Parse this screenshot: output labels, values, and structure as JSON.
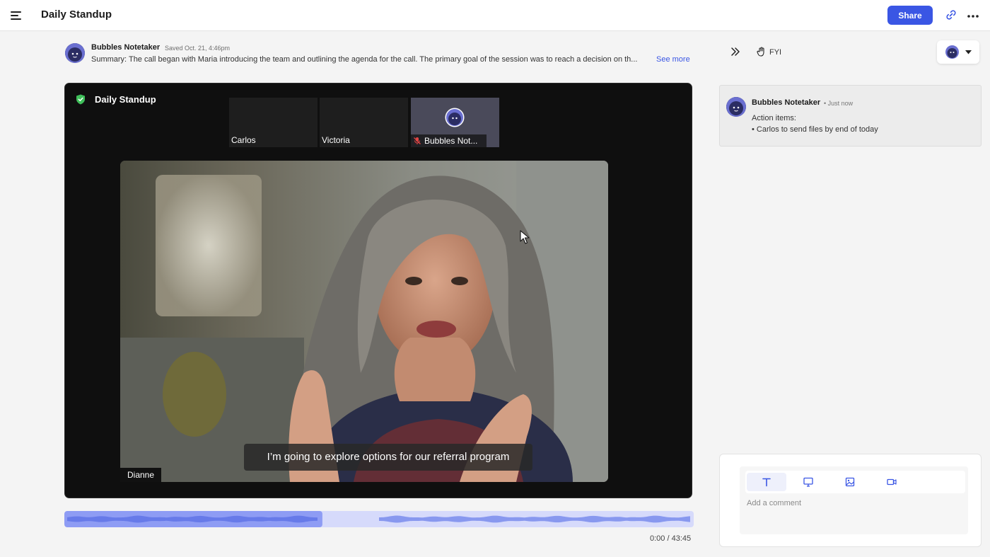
{
  "header": {
    "title": "Daily Standup",
    "share_label": "Share"
  },
  "summary": {
    "author": "Bubbles Notetaker",
    "saved": "Saved Oct. 21, 4:46pm",
    "text": "Summary: The call began with Maria introducing the team and outlining the agenda for the call. The primary goal of the session was to reach a decision on th...",
    "see_more": "See more"
  },
  "call": {
    "title": "Daily Standup",
    "participants": [
      "Carlos",
      "Victoria",
      "Bubbles Not..."
    ],
    "speaker": "Dianne",
    "caption": "I’m going to explore options for our referral program"
  },
  "playback": {
    "time": "0:00 / 43:45",
    "progress": 0.41
  },
  "sidebar": {
    "fyi_label": "FYI"
  },
  "comment": {
    "author": "Bubbles Notetaker",
    "time": "• Just now",
    "line1": "Action items:",
    "line2": "• Carlos to send files by end of today"
  },
  "composer": {
    "placeholder": "Add a comment",
    "tools": [
      "text-icon",
      "screen-icon",
      "image-icon",
      "video-icon"
    ]
  },
  "colors": {
    "accent": "#3a56e4",
    "wave_played": "#8e9cf4",
    "wave_unplayed": "#d6dafb"
  }
}
